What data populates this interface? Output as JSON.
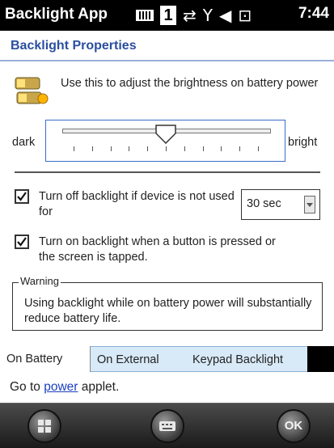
{
  "titlebar": {
    "app_name": "Backlight App",
    "clock": "7:44",
    "sim_indicator": "1"
  },
  "header": {
    "title": "Backlight Properties"
  },
  "brightness": {
    "description": "Use this to adjust the brightness on battery power",
    "min_label": "dark",
    "max_label": "bright",
    "level_fraction": 0.5
  },
  "options": {
    "turn_off_label": "Turn off backlight if device is not used for",
    "turn_off_checked": true,
    "timeout_value": "30 sec",
    "turn_on_label": "Turn on backlight when a button is pressed or the screen is tapped.",
    "turn_on_checked": true
  },
  "warning": {
    "legend": "Warning",
    "text": "Using backlight while on battery power will substantially reduce battery life."
  },
  "tabs": [
    {
      "label": "On Battery",
      "active": true
    },
    {
      "label": "On External",
      "active": false
    },
    {
      "label": "Keypad Backlight",
      "active": false
    }
  ],
  "footer_link": {
    "prefix": "Go to ",
    "link_text": "power",
    "suffix": " applet."
  },
  "softkeys": {
    "right_label": "OK"
  },
  "icons": [
    "battery-icon",
    "sim-icon",
    "data-sync-icon",
    "signal-off-icon",
    "volume-icon",
    "power-plug-icon",
    "windows-start-icon",
    "keyboard-icon",
    "ok-icon"
  ]
}
